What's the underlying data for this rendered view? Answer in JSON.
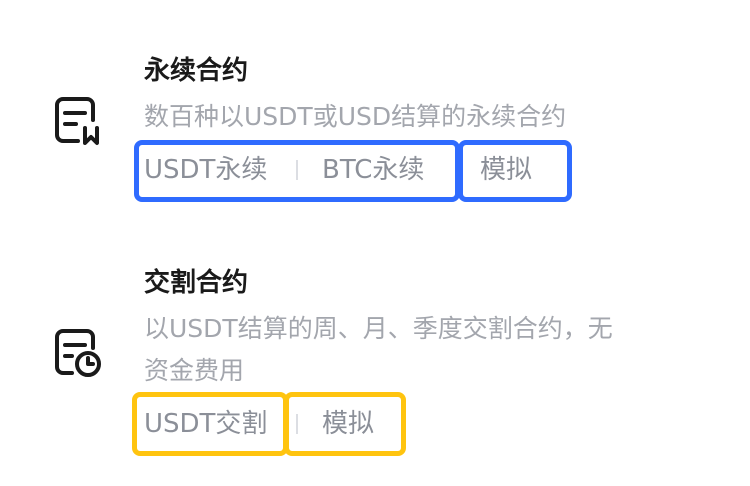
{
  "sections": [
    {
      "title": "永续合约",
      "desc_lines": [
        "数百种以USDT或USD结算的永续合约"
      ],
      "tags": [
        "USDT永续",
        "BTC永续",
        "模拟"
      ],
      "icon": "contract-document-icon"
    },
    {
      "title": "交割合约",
      "desc_lines": [
        "以USDT结算的周、月、季度交割合约，无",
        "资金费用"
      ],
      "tags": [
        "USDT交割",
        "模拟"
      ],
      "icon": "contract-clock-icon"
    }
  ],
  "colors": {
    "highlight_blue": "#2f6bff",
    "highlight_yellow": "#ffc40f",
    "title": "#1a1a1a",
    "desc": "#a3a6ad",
    "tag_text": "#8b8f98"
  }
}
